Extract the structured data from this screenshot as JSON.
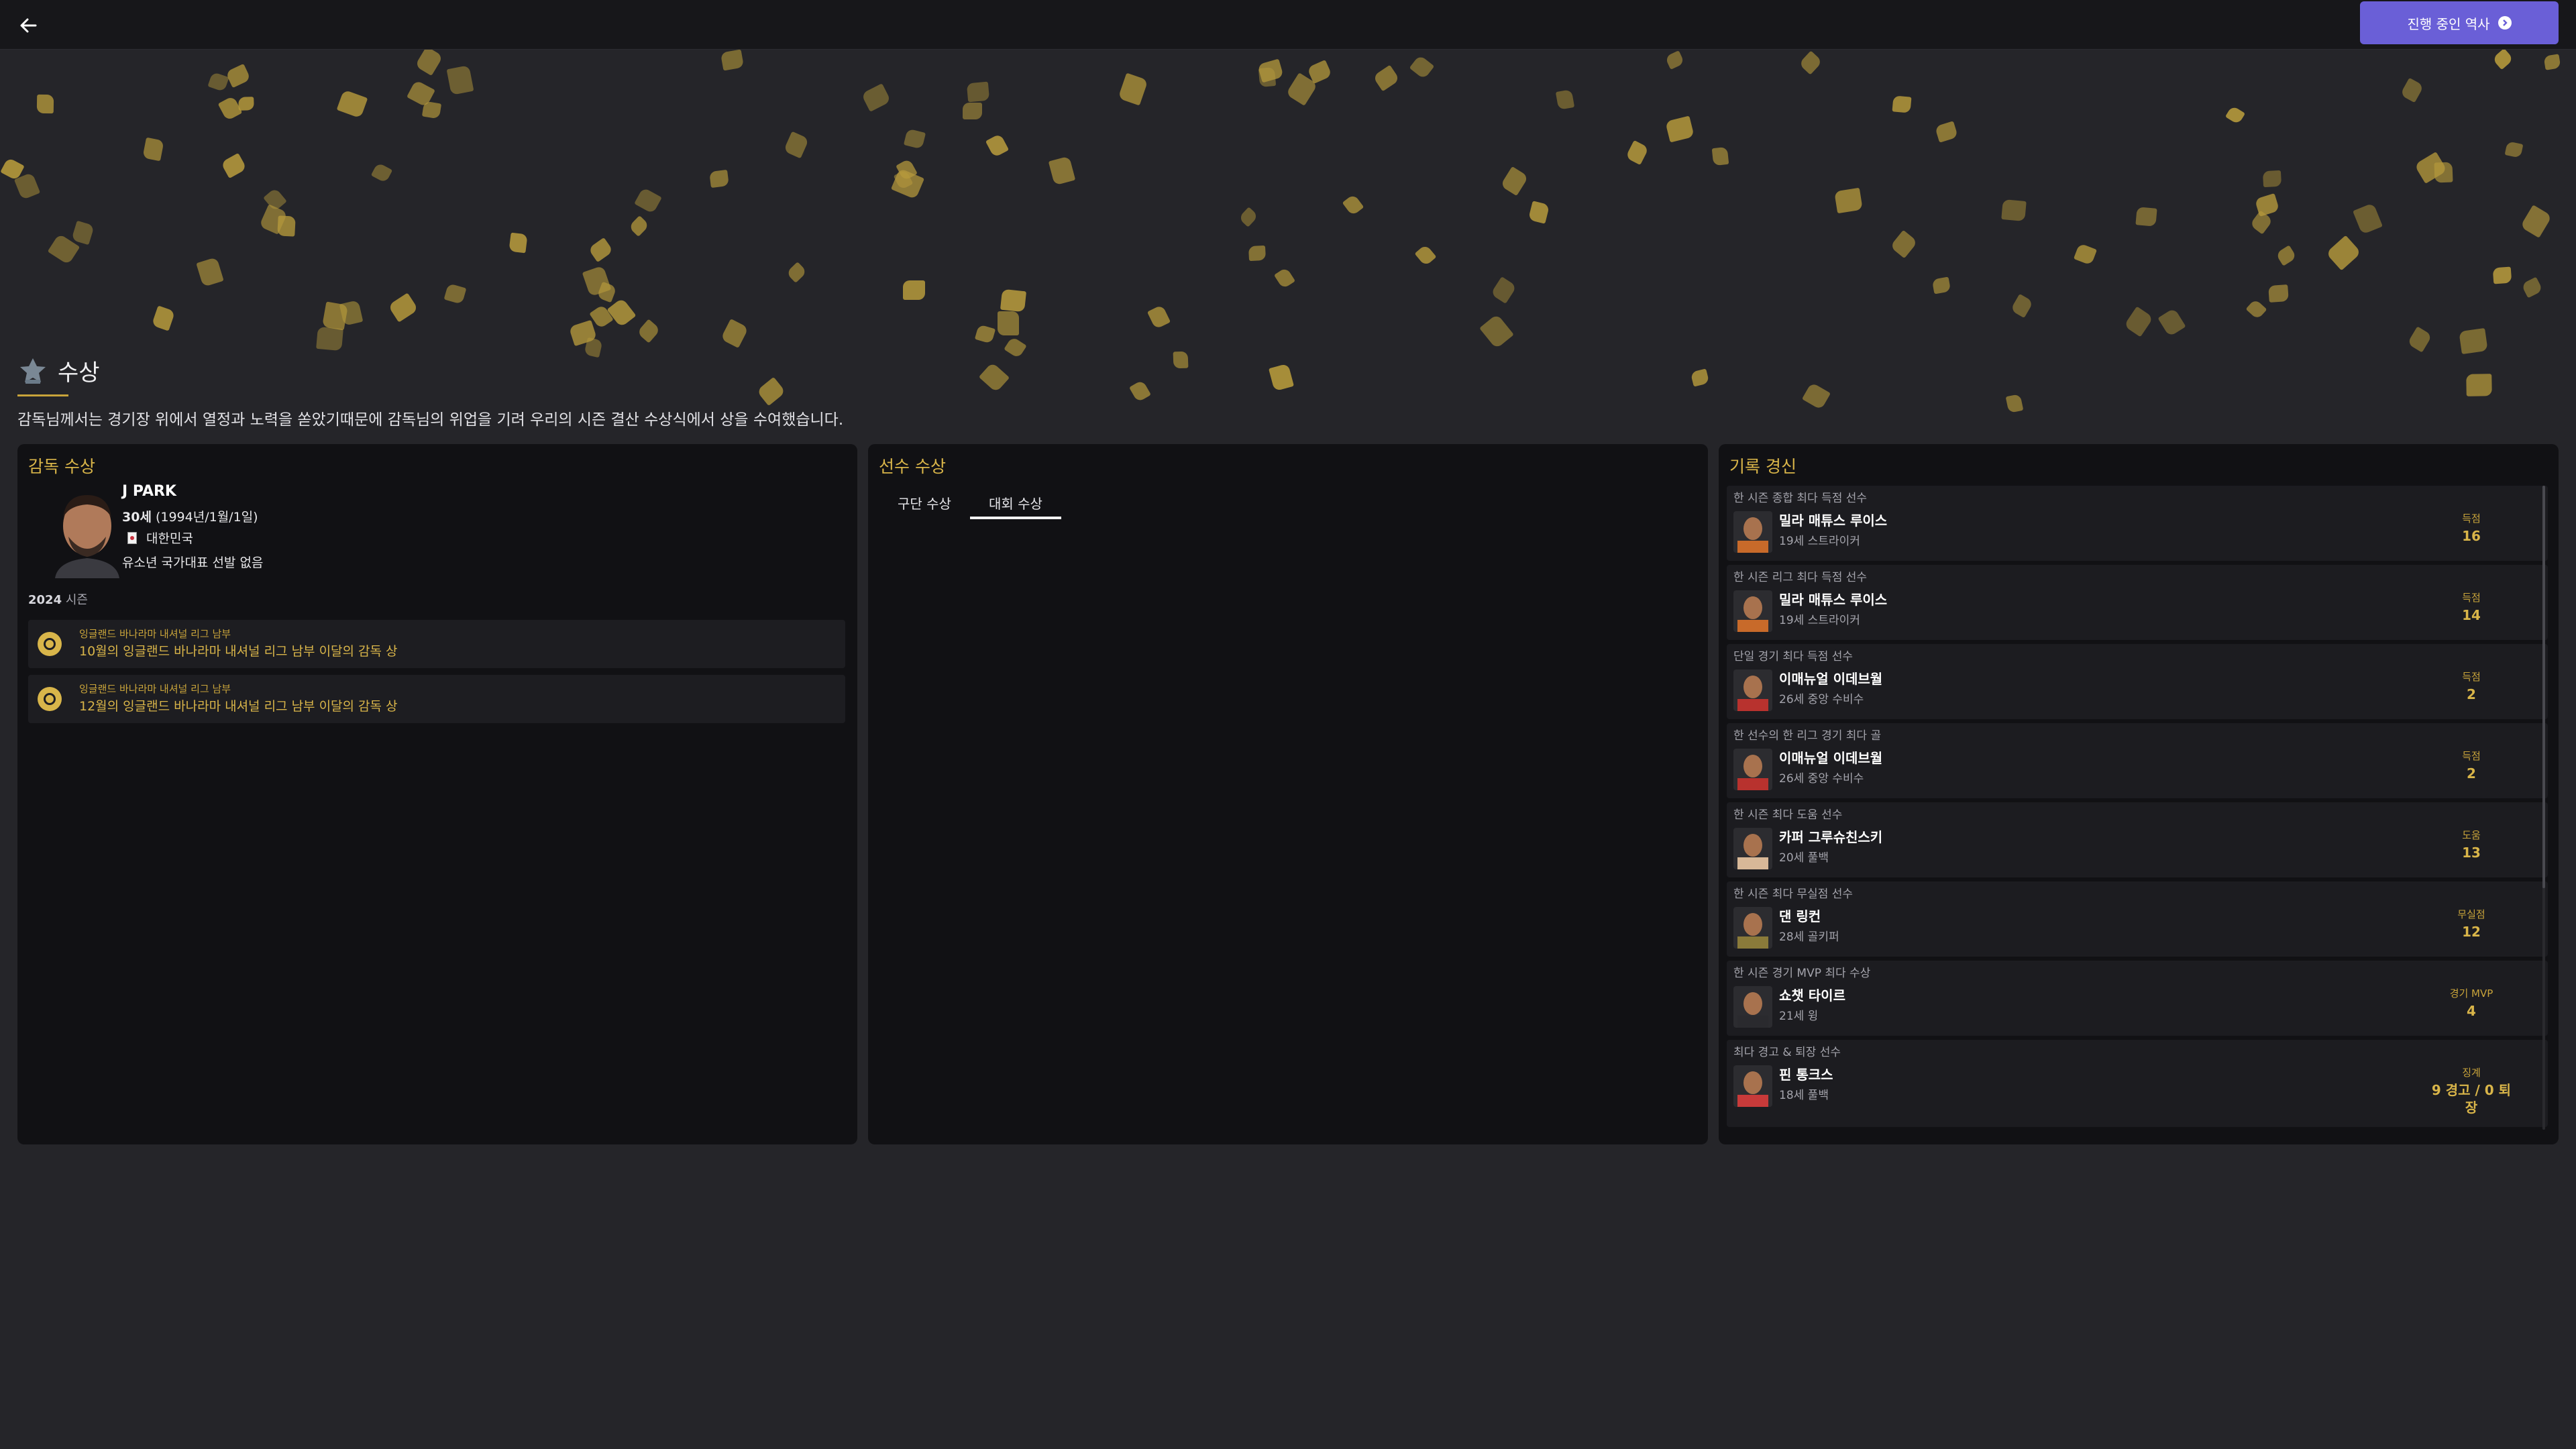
{
  "topbar": {
    "back_icon": "arrow-left-icon",
    "continue_label": "진행 중인 역사",
    "continue_icon": "chevron-right-circle-icon",
    "accent": "#6a5fd7"
  },
  "section": {
    "title": "수상",
    "icon": "trophy-icon",
    "description": "감독님께서는 경기장 위에서 열정과 노력을 쏟았기때문에 감독님의 위업을 기려 우리의 시즌 결산 수상식에서 상을 수여했습니다."
  },
  "manager_panel": {
    "title": "감독 수상",
    "name": "J PARK",
    "age": "30세",
    "birth": "(1994년/1월/1일)",
    "nation": "대한민국",
    "youth": "유소년 국가대표 선발 없음",
    "season_year": "2024",
    "season_suffix": "시즌",
    "awards": [
      {
        "competition": "잉글랜드 바나라마 내셔널 리그 남부",
        "title": "10월의 잉글랜드 바나라마 내셔널 리그 남부 이달의 감독 상",
        "icon": "medal-icon"
      },
      {
        "competition": "잉글랜드 바나라마 내셔널 리그 남부",
        "title": "12월의 잉글랜드 바나라마 내셔널 리그 남부 이달의 감독 상",
        "icon": "medal-icon"
      }
    ]
  },
  "player_panel": {
    "title": "선수 수상",
    "tabs": [
      {
        "label": "구단 수상",
        "active": false
      },
      {
        "label": "대회 수상",
        "active": true
      }
    ]
  },
  "records_panel": {
    "title": "기록 경신",
    "records": [
      {
        "record": "한 시즌 종합 최다 득점 선수",
        "player": "밀라 매튜스 루이스",
        "info": "19세 스트라이커",
        "stat_label": "득점",
        "stat_value": "16"
      },
      {
        "record": "한 시즌 리그 최다 득점 선수",
        "player": "밀라 매튜스 루이스",
        "info": "19세 스트라이커",
        "stat_label": "득점",
        "stat_value": "14"
      },
      {
        "record": "단일 경기 최다 득점 선수",
        "player": "이매뉴얼 이데브월",
        "info": "26세 중앙 수비수",
        "stat_label": "득점",
        "stat_value": "2"
      },
      {
        "record": "한 선수의 한 리그 경기 최다 골",
        "player": "이매뉴얼 이데브월",
        "info": "26세 중앙 수비수",
        "stat_label": "득점",
        "stat_value": "2"
      },
      {
        "record": "한 시즌 최다 도움 선수",
        "player": "카퍼 그루슈친스키",
        "info": "20세 풀백",
        "stat_label": "도움",
        "stat_value": "13"
      },
      {
        "record": "한 시즌 최다 무실점 선수",
        "player": "댄 링컨",
        "info": "28세 골키퍼",
        "stat_label": "무실점",
        "stat_value": "12"
      },
      {
        "record": "한 시즌 경기 MVP 최다 수상",
        "player": "쇼챗 타이르",
        "info": "21세 윙",
        "stat_label": "경기 MVP",
        "stat_value": "4"
      },
      {
        "record": "최다 경고 & 퇴장 선수",
        "player": "핀 통크스",
        "info": "18세 풀백",
        "stat_label": "징계",
        "stat_value": "9 경고 / 0 퇴장"
      }
    ]
  }
}
